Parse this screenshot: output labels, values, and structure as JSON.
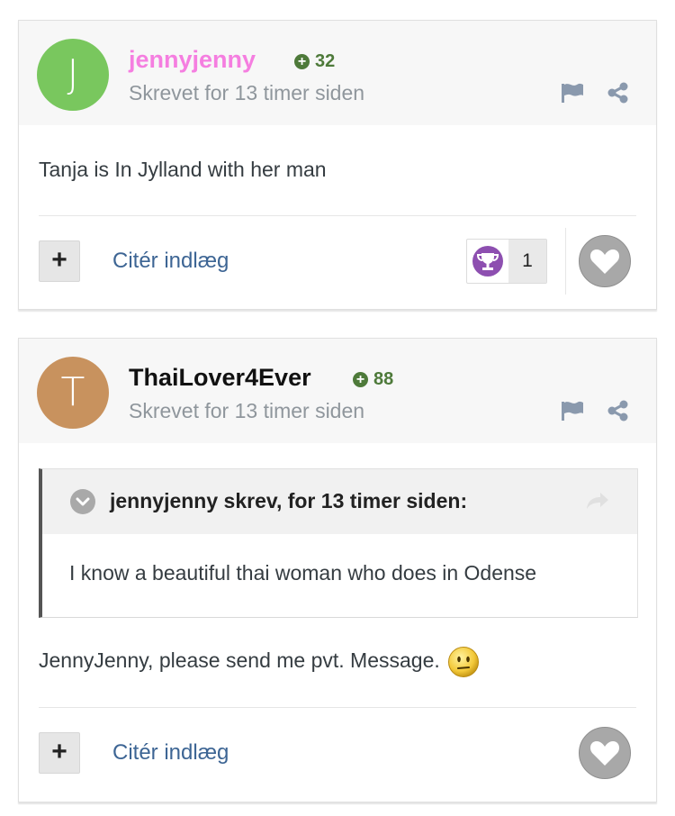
{
  "posts": [
    {
      "author": {
        "name": "jennyjenny",
        "name_color": "#f57ee0",
        "avatar_letter": "J",
        "avatar_color": "#79c75e",
        "reputation": "32"
      },
      "timestamp": "Skrevet for 13 timer siden",
      "content": "Tanja is In Jylland with her man",
      "actions": {
        "multiquote_label": "+",
        "quote_label": "Citér indlæg",
        "reaction_icon": "trophy-icon",
        "reaction_count": "1"
      }
    },
    {
      "author": {
        "name": "ThaiLover4Ever",
        "name_color": "#111111",
        "avatar_letter": "T",
        "avatar_color": "#c8925e",
        "reputation": "88"
      },
      "timestamp": "Skrevet for 13 timer siden",
      "quote": {
        "header": "jennyjenny skrev, for 13 timer siden:",
        "body": "I know a beautiful thai woman who does in Odense"
      },
      "content": "JennyJenny, please send me pvt. Message.",
      "content_emoji": "confused-face-icon",
      "actions": {
        "multiquote_label": "+",
        "quote_label": "Citér indlæg"
      }
    }
  ],
  "colors": {
    "reputation_green": "#4e7a3a",
    "link_blue": "#3d6594",
    "muted_gray": "#8f969c"
  }
}
